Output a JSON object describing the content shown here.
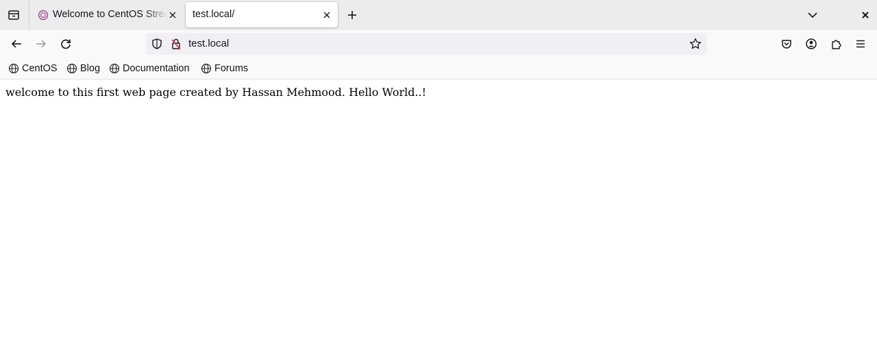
{
  "browser": {
    "tabs": [
      {
        "title": "Welcome to CentOS Stream",
        "active": false,
        "favicon": "centos-favicon"
      },
      {
        "title": "test.local/",
        "active": true,
        "favicon": ""
      }
    ],
    "address_bar": {
      "url": "test.local"
    },
    "bookmarks": [
      {
        "label": "CentOS",
        "icon": "globe-icon"
      },
      {
        "label": "Blog",
        "icon": "globe-icon"
      },
      {
        "label": "Documentation",
        "icon": "globe-icon"
      },
      {
        "label": "Forums",
        "icon": "globe-icon"
      }
    ]
  },
  "page": {
    "body_text": "welcome to this first web page created by Hassan Mehmood. Hello World..!"
  },
  "colors": {
    "tabbar_bg": "#ececee",
    "toolbar_bg": "#f9f9fb",
    "urlbar_bg": "#f0f0f4",
    "centos_purple": "#a14f8c"
  }
}
